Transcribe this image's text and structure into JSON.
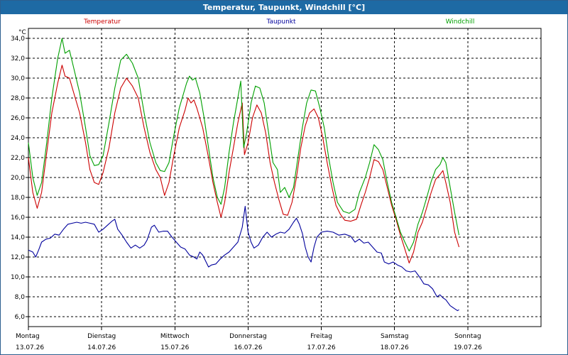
{
  "window": {
    "title": "Temperatur, Taupunkt, Windchill [°C]"
  },
  "chart_data": {
    "type": "line",
    "title": "Temperatur, Taupunkt, Windchill [°C]",
    "ylabel": "°C",
    "ylim": [
      5.0,
      35.0
    ],
    "yticks": [
      "34,0",
      "32,0",
      "30,0",
      "28,0",
      "26,0",
      "24,0",
      "22,0",
      "20,0",
      "18,0",
      "16,0",
      "14,0",
      "12,0",
      "10,0",
      "8,0",
      "6,0"
    ],
    "ytick_values": [
      34,
      32,
      30,
      28,
      26,
      24,
      22,
      20,
      18,
      16,
      14,
      12,
      10,
      8,
      6
    ],
    "x_days": [
      {
        "day": "Montag",
        "date": "13.07.26"
      },
      {
        "day": "Dienstag",
        "date": "14.07.26"
      },
      {
        "day": "Mittwoch",
        "date": "15.07.26"
      },
      {
        "day": "Donnerstag",
        "date": "16.07.26"
      },
      {
        "day": "Freitag",
        "date": "17.07.26"
      },
      {
        "day": "Samstag",
        "date": "18.07.26"
      },
      {
        "day": "Sonntag",
        "date": "19.07.26"
      }
    ],
    "grid": true,
    "legend_position": "top",
    "series": [
      {
        "name": "Temperatur",
        "color": "#cc0000",
        "points": [
          [
            0,
            22
          ],
          [
            0.06,
            18.5
          ],
          [
            0.12,
            16.9
          ],
          [
            0.18,
            18.5
          ],
          [
            0.25,
            22.5
          ],
          [
            0.32,
            26.5
          ],
          [
            0.4,
            29.5
          ],
          [
            0.46,
            31.3
          ],
          [
            0.5,
            30.2
          ],
          [
            0.56,
            30
          ],
          [
            0.62,
            28.5
          ],
          [
            0.7,
            26.5
          ],
          [
            0.78,
            23.5
          ],
          [
            0.84,
            20.8
          ],
          [
            0.9,
            19.5
          ],
          [
            0.96,
            19.3
          ],
          [
            1.02,
            20.5
          ],
          [
            1.1,
            23
          ],
          [
            1.18,
            26.5
          ],
          [
            1.26,
            29
          ],
          [
            1.34,
            30
          ],
          [
            1.42,
            29.2
          ],
          [
            1.5,
            28
          ],
          [
            1.58,
            25
          ],
          [
            1.66,
            22.5
          ],
          [
            1.74,
            20.8
          ],
          [
            1.8,
            20
          ],
          [
            1.86,
            18.2
          ],
          [
            1.92,
            19.5
          ],
          [
            1.98,
            22
          ],
          [
            2.06,
            25
          ],
          [
            2.14,
            26.8
          ],
          [
            2.18,
            28
          ],
          [
            2.22,
            27.5
          ],
          [
            2.26,
            27.8
          ],
          [
            2.3,
            27
          ],
          [
            2.38,
            25
          ],
          [
            2.46,
            22
          ],
          [
            2.52,
            19.5
          ],
          [
            2.58,
            17.5
          ],
          [
            2.63,
            16
          ],
          [
            2.68,
            17.5
          ],
          [
            2.74,
            20.5
          ],
          [
            2.8,
            23
          ],
          [
            2.86,
            25.5
          ],
          [
            2.92,
            27.5
          ],
          [
            2.95,
            22.3
          ],
          [
            3.0,
            23.5
          ],
          [
            3.06,
            26
          ],
          [
            3.12,
            27.3
          ],
          [
            3.18,
            26.5
          ],
          [
            3.24,
            24.5
          ],
          [
            3.3,
            21.5
          ],
          [
            3.36,
            19.5
          ],
          [
            3.42,
            17.8
          ],
          [
            3.48,
            16.3
          ],
          [
            3.54,
            16.2
          ],
          [
            3.6,
            17.5
          ],
          [
            3.66,
            20
          ],
          [
            3.72,
            23
          ],
          [
            3.78,
            25.2
          ],
          [
            3.84,
            26.5
          ],
          [
            3.9,
            26.9
          ],
          [
            3.96,
            26
          ],
          [
            4.02,
            24
          ],
          [
            4.08,
            21.5
          ],
          [
            4.14,
            19.2
          ],
          [
            4.2,
            17.2
          ],
          [
            4.26,
            16.3
          ],
          [
            4.32,
            15.7
          ],
          [
            4.4,
            15.6
          ],
          [
            4.48,
            15.8
          ],
          [
            4.54,
            17.2
          ],
          [
            4.6,
            18.5
          ],
          [
            4.66,
            20
          ],
          [
            4.72,
            21.8
          ],
          [
            4.78,
            21.6
          ],
          [
            4.84,
            20.8
          ],
          [
            4.9,
            19
          ],
          [
            4.96,
            17.2
          ],
          [
            5.02,
            15.8
          ],
          [
            5.08,
            14.2
          ],
          [
            5.14,
            12.8
          ],
          [
            5.2,
            11.4
          ],
          [
            5.26,
            12.5
          ],
          [
            5.32,
            14.5
          ],
          [
            5.38,
            15.5
          ],
          [
            5.44,
            17
          ],
          [
            5.5,
            18.5
          ],
          [
            5.56,
            19.8
          ],
          [
            5.62,
            20.3
          ],
          [
            5.66,
            20.7
          ],
          [
            5.7,
            19.5
          ],
          [
            5.76,
            17.5
          ],
          [
            5.82,
            14.5
          ],
          [
            5.88,
            13
          ]
        ]
      },
      {
        "name": "Taupunkt",
        "color": "#00009c",
        "points": [
          [
            0,
            12.7
          ],
          [
            0.06,
            12.5
          ],
          [
            0.1,
            12
          ],
          [
            0.14,
            12.7
          ],
          [
            0.18,
            13.5
          ],
          [
            0.24,
            13.8
          ],
          [
            0.3,
            13.9
          ],
          [
            0.36,
            14.3
          ],
          [
            0.42,
            14.2
          ],
          [
            0.48,
            14.8
          ],
          [
            0.54,
            15.3
          ],
          [
            0.6,
            15.4
          ],
          [
            0.66,
            15.5
          ],
          [
            0.72,
            15.4
          ],
          [
            0.78,
            15.5
          ],
          [
            0.84,
            15.4
          ],
          [
            0.9,
            15.3
          ],
          [
            0.96,
            14.5
          ],
          [
            1.02,
            14.8
          ],
          [
            1.08,
            15.2
          ],
          [
            1.14,
            15.6
          ],
          [
            1.18,
            15.8
          ],
          [
            1.22,
            14.8
          ],
          [
            1.28,
            14.2
          ],
          [
            1.34,
            13.5
          ],
          [
            1.4,
            12.9
          ],
          [
            1.46,
            13.2
          ],
          [
            1.52,
            12.9
          ],
          [
            1.58,
            13.2
          ],
          [
            1.62,
            13.7
          ],
          [
            1.68,
            15
          ],
          [
            1.72,
            15.2
          ],
          [
            1.78,
            14.5
          ],
          [
            1.84,
            14.6
          ],
          [
            1.9,
            14.6
          ],
          [
            1.96,
            14
          ],
          [
            2.02,
            13.5
          ],
          [
            2.08,
            13
          ],
          [
            2.14,
            12.8
          ],
          [
            2.2,
            12.2
          ],
          [
            2.26,
            12
          ],
          [
            2.3,
            11.8
          ],
          [
            2.34,
            12.5
          ],
          [
            2.38,
            12.2
          ],
          [
            2.42,
            11.6
          ],
          [
            2.46,
            11
          ],
          [
            2.5,
            11.2
          ],
          [
            2.56,
            11.3
          ],
          [
            2.62,
            11.8
          ],
          [
            2.68,
            12.2
          ],
          [
            2.74,
            12.5
          ],
          [
            2.8,
            13
          ],
          [
            2.86,
            13.5
          ],
          [
            2.92,
            15
          ],
          [
            2.96,
            17.1
          ],
          [
            3.0,
            14.5
          ],
          [
            3.04,
            13.5
          ],
          [
            3.08,
            12.9
          ],
          [
            3.14,
            13.2
          ],
          [
            3.2,
            14
          ],
          [
            3.26,
            14.5
          ],
          [
            3.32,
            14
          ],
          [
            3.38,
            14.3
          ],
          [
            3.44,
            14.5
          ],
          [
            3.5,
            14.4
          ],
          [
            3.56,
            14.8
          ],
          [
            3.62,
            15.5
          ],
          [
            3.66,
            15.9
          ],
          [
            3.7,
            15.3
          ],
          [
            3.74,
            14.4
          ],
          [
            3.78,
            13
          ],
          [
            3.82,
            12
          ],
          [
            3.86,
            11.5
          ],
          [
            3.9,
            13
          ],
          [
            3.94,
            14
          ],
          [
            4.0,
            14.5
          ],
          [
            4.08,
            14.6
          ],
          [
            4.16,
            14.5
          ],
          [
            4.24,
            14.2
          ],
          [
            4.32,
            14.3
          ],
          [
            4.4,
            14.1
          ],
          [
            4.46,
            13.5
          ],
          [
            4.52,
            13.8
          ],
          [
            4.58,
            13.4
          ],
          [
            4.64,
            13.5
          ],
          [
            4.7,
            13
          ],
          [
            4.76,
            12.5
          ],
          [
            4.82,
            12.4
          ],
          [
            4.86,
            11.5
          ],
          [
            4.92,
            11.3
          ],
          [
            4.98,
            11.5
          ],
          [
            5.04,
            11.2
          ],
          [
            5.1,
            11
          ],
          [
            5.16,
            10.6
          ],
          [
            5.22,
            10.5
          ],
          [
            5.28,
            10.6
          ],
          [
            5.34,
            10
          ],
          [
            5.4,
            9.3
          ],
          [
            5.46,
            9.2
          ],
          [
            5.52,
            8.8
          ],
          [
            5.58,
            8
          ],
          [
            5.62,
            8.2
          ],
          [
            5.66,
            7.9
          ],
          [
            5.7,
            7.7
          ],
          [
            5.76,
            7.1
          ],
          [
            5.82,
            6.8
          ],
          [
            5.86,
            6.6
          ],
          [
            5.88,
            6.7
          ]
        ]
      },
      {
        "name": "Windchill",
        "color": "#00a000",
        "points": [
          [
            0,
            23.5
          ],
          [
            0.06,
            20
          ],
          [
            0.12,
            18.2
          ],
          [
            0.18,
            19.5
          ],
          [
            0.25,
            23.5
          ],
          [
            0.32,
            28
          ],
          [
            0.4,
            32
          ],
          [
            0.46,
            34
          ],
          [
            0.5,
            32.5
          ],
          [
            0.56,
            32.8
          ],
          [
            0.62,
            31
          ],
          [
            0.7,
            28.5
          ],
          [
            0.78,
            25
          ],
          [
            0.84,
            22.2
          ],
          [
            0.9,
            21.2
          ],
          [
            0.96,
            21.3
          ],
          [
            1.02,
            22.2
          ],
          [
            1.1,
            25.5
          ],
          [
            1.18,
            29
          ],
          [
            1.26,
            31.8
          ],
          [
            1.34,
            32.4
          ],
          [
            1.42,
            31.5
          ],
          [
            1.5,
            30
          ],
          [
            1.58,
            26.5
          ],
          [
            1.66,
            23.5
          ],
          [
            1.74,
            21.5
          ],
          [
            1.8,
            20.7
          ],
          [
            1.86,
            20.6
          ],
          [
            1.92,
            21.5
          ],
          [
            1.98,
            24
          ],
          [
            2.06,
            27
          ],
          [
            2.12,
            28.5
          ],
          [
            2.16,
            29.5
          ],
          [
            2.2,
            30.2
          ],
          [
            2.24,
            29.8
          ],
          [
            2.28,
            30
          ],
          [
            2.34,
            28.5
          ],
          [
            2.4,
            26
          ],
          [
            2.46,
            23
          ],
          [
            2.52,
            20
          ],
          [
            2.58,
            18
          ],
          [
            2.63,
            17.3
          ],
          [
            2.68,
            19
          ],
          [
            2.74,
            22.5
          ],
          [
            2.8,
            25.5
          ],
          [
            2.86,
            28
          ],
          [
            2.9,
            29.7
          ],
          [
            2.94,
            23
          ],
          [
            2.98,
            24.5
          ],
          [
            3.04,
            27.5
          ],
          [
            3.1,
            29.2
          ],
          [
            3.16,
            29
          ],
          [
            3.22,
            27.5
          ],
          [
            3.28,
            24.5
          ],
          [
            3.34,
            21.5
          ],
          [
            3.4,
            20.8
          ],
          [
            3.44,
            18.5
          ],
          [
            3.5,
            19
          ],
          [
            3.56,
            18
          ],
          [
            3.62,
            19
          ],
          [
            3.68,
            22
          ],
          [
            3.74,
            25
          ],
          [
            3.8,
            27.5
          ],
          [
            3.86,
            28.8
          ],
          [
            3.92,
            28.7
          ],
          [
            3.98,
            27
          ],
          [
            4.04,
            25
          ],
          [
            4.1,
            22
          ],
          [
            4.16,
            19.5
          ],
          [
            4.22,
            17.5
          ],
          [
            4.3,
            16.6
          ],
          [
            4.38,
            16.4
          ],
          [
            4.46,
            16.8
          ],
          [
            4.52,
            18.5
          ],
          [
            4.6,
            20
          ],
          [
            4.66,
            21.5
          ],
          [
            4.72,
            23.3
          ],
          [
            4.78,
            22.8
          ],
          [
            4.84,
            21.8
          ],
          [
            4.9,
            19.5
          ],
          [
            4.96,
            17.5
          ],
          [
            5.02,
            16
          ],
          [
            5.08,
            14.5
          ],
          [
            5.14,
            13.5
          ],
          [
            5.2,
            12.6
          ],
          [
            5.26,
            13.5
          ],
          [
            5.32,
            15.3
          ],
          [
            5.38,
            16.5
          ],
          [
            5.44,
            18
          ],
          [
            5.5,
            19.6
          ],
          [
            5.56,
            20.8
          ],
          [
            5.62,
            21.3
          ],
          [
            5.66,
            22
          ],
          [
            5.7,
            21.5
          ],
          [
            5.76,
            19
          ],
          [
            5.82,
            16.5
          ],
          [
            5.88,
            14.2
          ]
        ]
      }
    ]
  }
}
